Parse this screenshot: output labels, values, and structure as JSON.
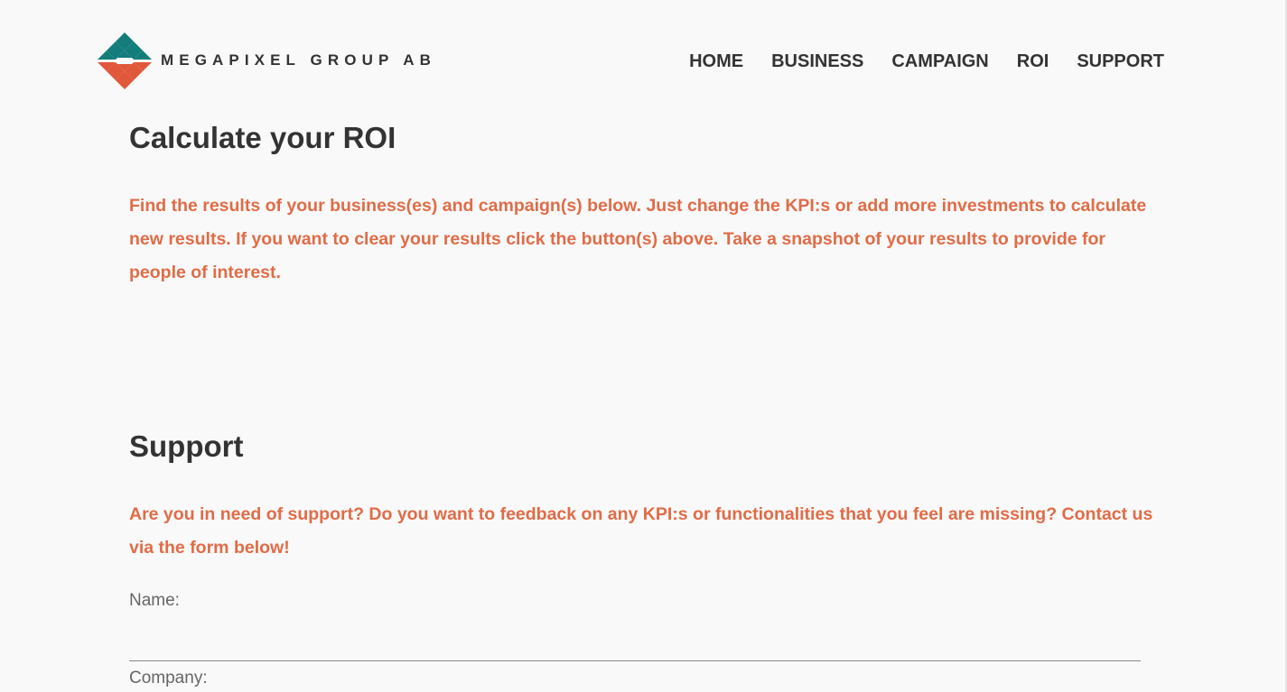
{
  "brand": {
    "name": "MEGAPIXEL GROUP AB",
    "colors": {
      "teal": "#127d7b",
      "orange": "#e0573a",
      "text": "#333333",
      "accent_text": "#e06c47"
    }
  },
  "nav": {
    "items": [
      {
        "label": "HOME"
      },
      {
        "label": "BUSINESS"
      },
      {
        "label": "CAMPAIGN"
      },
      {
        "label": "ROI"
      },
      {
        "label": "SUPPORT"
      }
    ]
  },
  "roi": {
    "title": "Calculate your ROI",
    "text": "Find the results of your business(es) and campaign(s) below. Just change the KPI:s or add more investments to calculate new results. If you want to clear your results click the button(s) above. Take a snapshot of your results to provide for people of interest."
  },
  "support": {
    "title": "Support",
    "text": "Are you in need of support? Do you want to feedback on any KPI:s or functionalities that you feel are missing? Contact us via the form below!",
    "form": {
      "name_label": "Name:",
      "name_value": "",
      "company_label": "Company:",
      "company_value": ""
    }
  }
}
